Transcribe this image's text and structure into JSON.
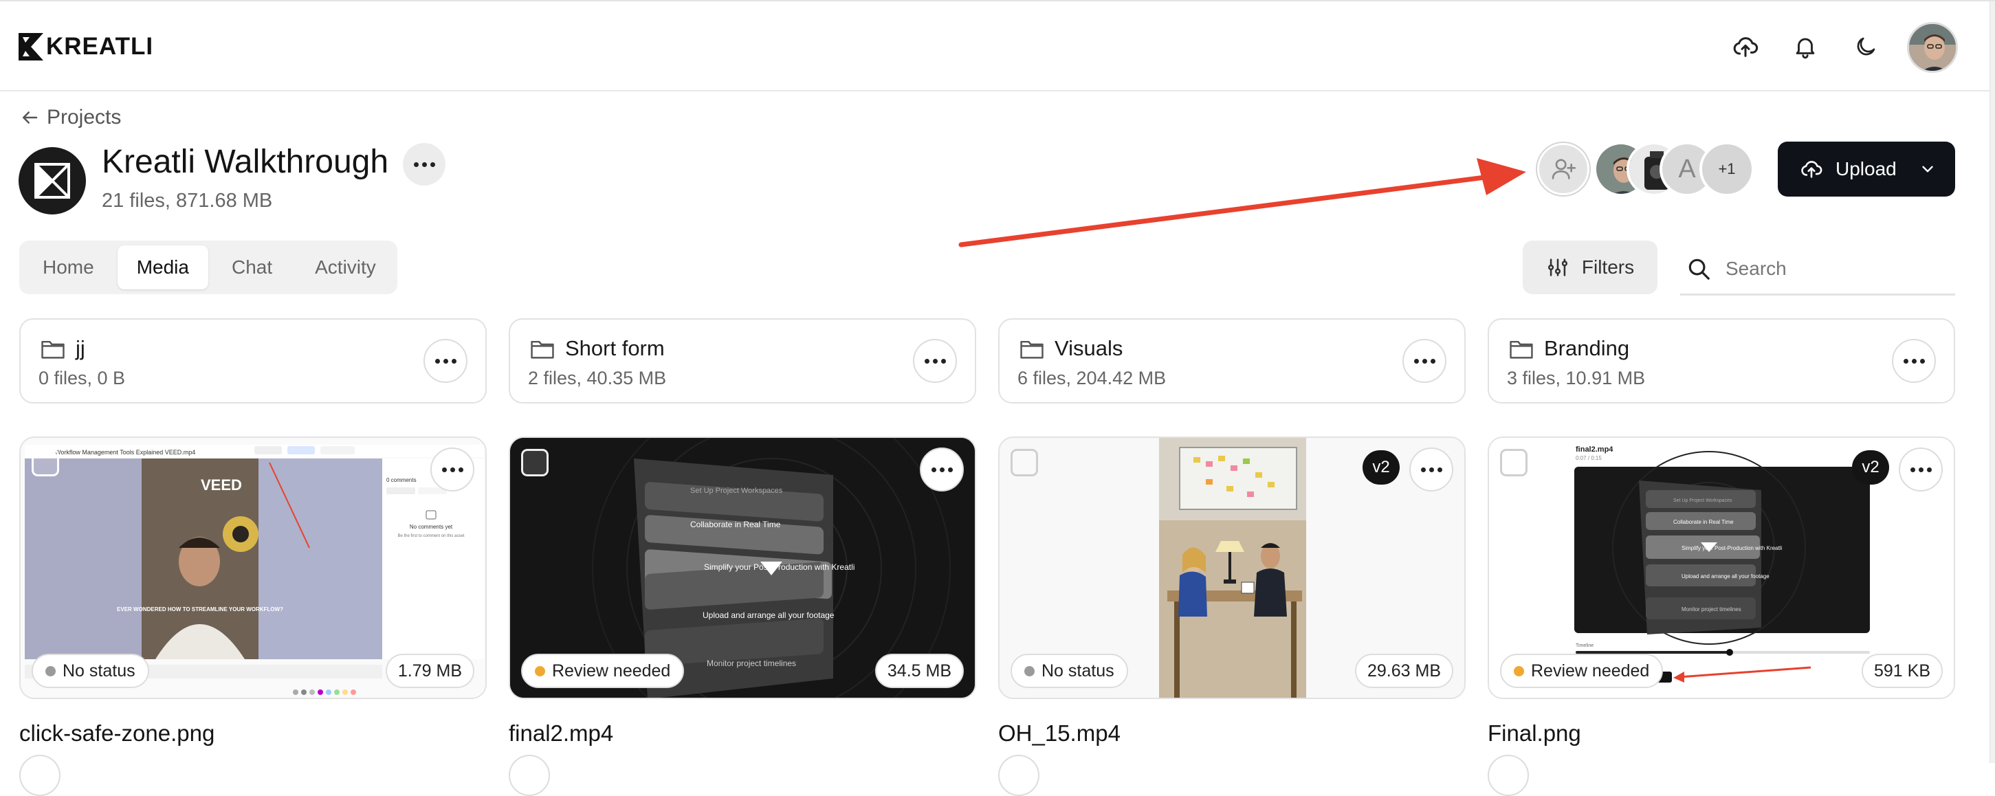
{
  "brand": {
    "name": "KREATLI"
  },
  "header": {
    "icons": [
      "cloud-upload-icon",
      "bell-icon",
      "moon-icon"
    ],
    "avatar": "user-avatar"
  },
  "project": {
    "back_label": "Projects",
    "title": "Kreatli Walkthrough",
    "meta": "21 files, 871.68 MB",
    "members": [
      {
        "type": "photo"
      },
      {
        "type": "photo"
      },
      {
        "type": "letter",
        "letter": "A"
      },
      {
        "type": "more",
        "label": "+1"
      }
    ],
    "upload_label": "Upload"
  },
  "tabs": [
    {
      "label": "Home",
      "active": false
    },
    {
      "label": "Media",
      "active": true
    },
    {
      "label": "Chat",
      "active": false
    },
    {
      "label": "Activity",
      "active": false
    }
  ],
  "toolbar": {
    "filters_label": "Filters",
    "search_placeholder": "Search"
  },
  "folders": [
    {
      "name": "jj",
      "meta": "0 files, 0 B"
    },
    {
      "name": "Short form",
      "meta": "2 files, 40.35 MB"
    },
    {
      "name": "Visuals",
      "meta": "6 files, 204.42 MB"
    },
    {
      "name": "Branding",
      "meta": "3 files, 10.91 MB"
    }
  ],
  "files": [
    {
      "name": "click-safe-zone.png",
      "status": "No status",
      "status_color": "#9a9a9a",
      "size": "1.79 MB",
      "version": ""
    },
    {
      "name": "final2.mp4",
      "status": "Review needed",
      "status_color": "#f0a830",
      "size": "34.5 MB",
      "version": ""
    },
    {
      "name": "OH_15.mp4",
      "status": "No status",
      "status_color": "#9a9a9a",
      "size": "29.63 MB",
      "version": "v2"
    },
    {
      "name": "Final.png",
      "status": "Review needed",
      "status_color": "#f0a830",
      "size": "591 KB",
      "version": "v2"
    }
  ],
  "thumbnail_text": {
    "final2_steps": [
      "Set Up Project Workspaces",
      "Collaborate in Real Time",
      "Simplify your Post-Production with Kreatli",
      "Upload and arrange all your footage",
      "Monitor project timelines"
    ],
    "final_png_title": "final2.mp4",
    "final_png_time": "0:07 / 0:15",
    "final_png_timeline": "Timeline",
    "final_png_steps": [
      "Set Up Project Workspaces",
      "Collaborate in Real Time",
      "Simplify your Post-Production with Kreatli",
      "Upload and arrange all your footage",
      "Monitor project timelines"
    ],
    "veed_title": "Workflow Management Tools Explained VEED.mp4",
    "veed_caption": "EVER WONDERED HOW TO STREAMLINE YOUR WORKFLOW?",
    "veed_logo": "VEED",
    "veed_comments": "0 comments",
    "veed_no_comments": "No comments yet",
    "veed_hint": "Be the first to comment on this asset"
  },
  "annotation": {
    "arrow_color": "#e8412e"
  }
}
